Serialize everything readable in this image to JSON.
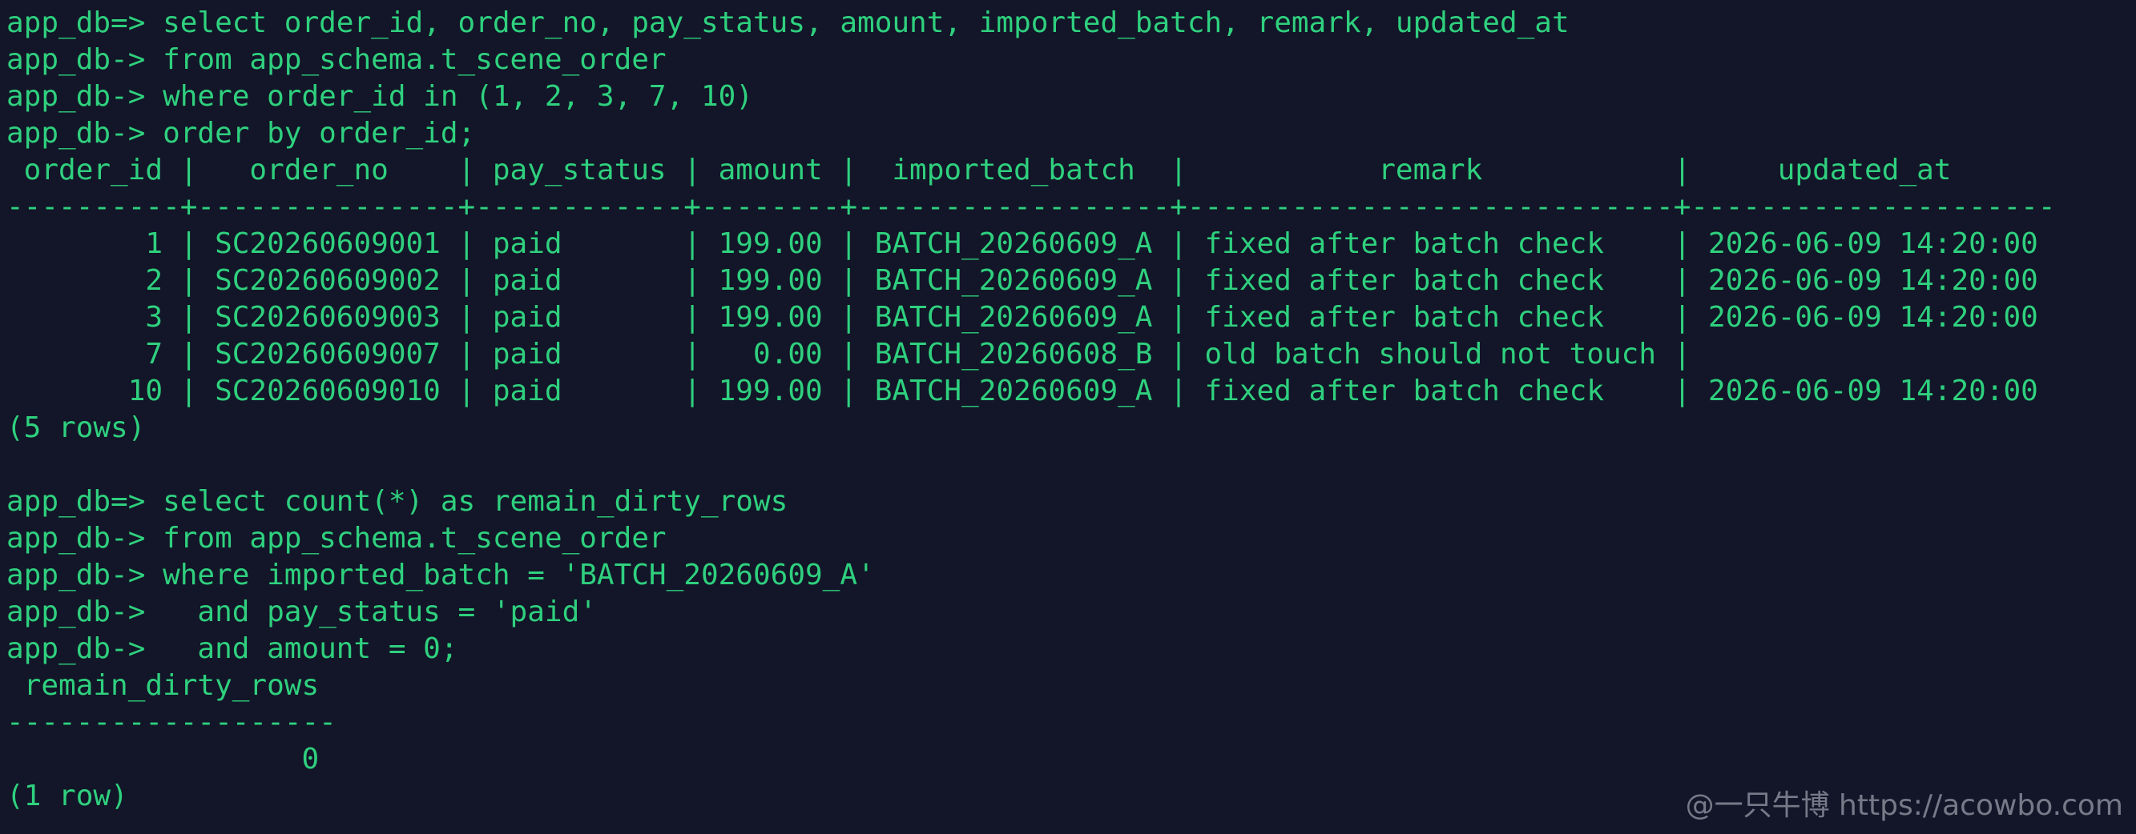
{
  "terminal": {
    "lines": [
      "app_db=> select order_id, order_no, pay_status, amount, imported_batch, remark, updated_at",
      "app_db-> from app_schema.t_scene_order",
      "app_db-> where order_id in (1, 2, 3, 7, 10)",
      "app_db-> order by order_id;",
      " order_id |   order_no    | pay_status | amount |  imported_batch  |           remark           |     updated_at",
      "----------+---------------+------------+--------+------------------+----------------------------+---------------------",
      "        1 | SC20260609001 | paid       | 199.00 | BATCH_20260609_A | fixed after batch check    | 2026-06-09 14:20:00",
      "        2 | SC20260609002 | paid       | 199.00 | BATCH_20260609_A | fixed after batch check    | 2026-06-09 14:20:00",
      "        3 | SC20260609003 | paid       | 199.00 | BATCH_20260609_A | fixed after batch check    | 2026-06-09 14:20:00",
      "        7 | SC20260609007 | paid       |   0.00 | BATCH_20260608_B | old batch should not touch |",
      "       10 | SC20260609010 | paid       | 199.00 | BATCH_20260609_A | fixed after batch check    | 2026-06-09 14:20:00",
      "(5 rows)",
      "",
      "app_db=> select count(*) as remain_dirty_rows",
      "app_db-> from app_schema.t_scene_order",
      "app_db-> where imported_batch = 'BATCH_20260609_A'",
      "app_db->   and pay_status = 'paid'",
      "app_db->   and amount = 0;",
      " remain_dirty_rows",
      "-------------------",
      "                 0",
      "(1 row)"
    ]
  },
  "watermark": "@一只牛博 https://acowbo.com",
  "colors": {
    "background": "#121628",
    "text": "#2fd07e",
    "watermark": "#c8cdd7"
  }
}
